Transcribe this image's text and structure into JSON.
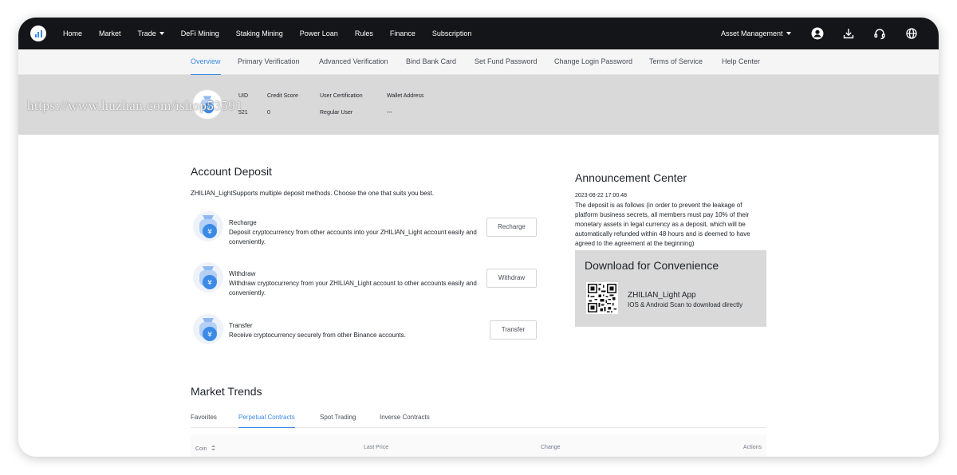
{
  "topnav": {
    "items": [
      {
        "label": "Home"
      },
      {
        "label": "Market"
      },
      {
        "label": "Trade",
        "has_dropdown": true
      },
      {
        "label": "DeFi Mining"
      },
      {
        "label": "Staking Mining"
      },
      {
        "label": "Power Loan"
      },
      {
        "label": "Rules"
      },
      {
        "label": "Finance"
      },
      {
        "label": "Subscription"
      }
    ],
    "asset_management": "Asset Management",
    "icons": [
      "user-icon",
      "download-icon",
      "headset-icon",
      "globe-icon"
    ]
  },
  "subnav": {
    "tabs": [
      {
        "label": "Overview",
        "active": true
      },
      {
        "label": "Primary Verification"
      },
      {
        "label": "Advanced Verification"
      },
      {
        "label": "Bind Bank Card"
      },
      {
        "label": "Set Fund Password"
      },
      {
        "label": "Change Login Password"
      },
      {
        "label": "Terms of Service"
      },
      {
        "label": "Help Center"
      }
    ]
  },
  "profile": {
    "uid_label": "UID",
    "uid_value": "521",
    "credit_label": "Credit Score",
    "credit_value": "0",
    "cert_label": "User Certification",
    "cert_value": "Regular User",
    "wallet_label": "Wallet Address",
    "wallet_value": "---",
    "watermark": "https://www.huzhan.com/ishop53591"
  },
  "deposit": {
    "title": "Account Deposit",
    "description": "ZHILIAN_LightSupports multiple deposit methods. Choose the one that suits you best.",
    "items": [
      {
        "title": "Recharge",
        "desc": "Deposit cryptocurrency from other accounts into your ZHILIAN_Light account easily and conveniently.",
        "button": "Recharge"
      },
      {
        "title": "Withdraw",
        "desc": "Withdraw cryptocurrency from your ZHILIAN_Light account to other accounts easily and conveniently.",
        "button": "Withdraw"
      },
      {
        "title": "Transfer",
        "desc": "Receive cryptocurrency securely from other Binance accounts.",
        "button": "Transfer"
      }
    ]
  },
  "announcement": {
    "title": "Announcement Center",
    "date": "2023-08-22 17:00:48",
    "text": "The deposit is as follows (in order to prevent the leakage of platform business secrets, all members must pay 10% of their monetary assets in legal currency as a deposit, which will be automatically refunded within 48 hours and is deemed to have agreed to the agreement at the beginning)"
  },
  "download": {
    "title": "Download for Convenience",
    "app_name": "ZHILIAN_Light App",
    "subtitle": "IOS & Android Scan to download directly"
  },
  "market": {
    "title": "Market Trends",
    "tabs": [
      {
        "label": "Favorites"
      },
      {
        "label": "Perpetual Contracts",
        "active": true
      },
      {
        "label": "Spot Trading"
      },
      {
        "label": "Inverse Contracts"
      }
    ],
    "columns": {
      "coin": "Coin",
      "last_price": "Last Price",
      "change": "Change",
      "actions": "Actions"
    }
  },
  "colors": {
    "accent": "#3b8ae6",
    "nav_bg": "#141518",
    "band_bg": "#d9d9d9"
  }
}
